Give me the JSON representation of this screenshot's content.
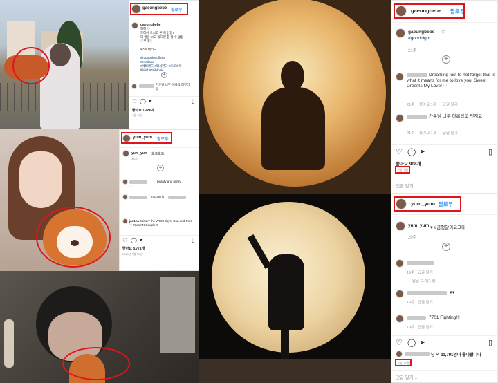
{
  "post1": {
    "username": "gaeungbebe",
    "follow": "팔로우",
    "caption_user": "gaeungbebe",
    "caption_lines": [
      "헤헤 ♡",
      "드디어 오시고 온 이 인형T",
      "데 얼굴 보고 있으면 힘 살 수 없음",
      "♡무해♡",
      "",
      "#스토베리도",
      "",
      "@3doubleoofficial",
      "#everland",
      "#에버랜드 #레서판다 #오토바이",
      "#ootd #dailylook"
    ],
    "time": "21주",
    "comment1": "가운님 너무 이뻐요 러뷰러뷰",
    "likes": "좋아요 1,486개",
    "date": "3월 16일"
  },
  "post2": {
    "username": "yum_yum",
    "follow": "팔로우",
    "caption_user": "yum_yum",
    "caption": "호호호호.",
    "time": "46주",
    "comments": [
      "beauty and pretty",
      "racoon is",
      "Missin' the WGM days! Gun and Pora ♡ #zoomN Couple ♥"
    ],
    "comment_user3": "jae1na",
    "likes": "좋아요 8,771개",
    "date": "2018년 3월 30일"
  },
  "post3": {
    "username": "gaeungbebe",
    "follow": "팔로우",
    "caption_user": "gaeungbebe",
    "caption_emoji": "♡",
    "hashtag": "#goodnight",
    "time": "21주",
    "comment1_text": "Dreaming just to not forget that is what it means for me to love you. Sweet Dreams My Love! ♡",
    "comment1_meta": [
      "21주",
      "좋아요 1개",
      "답글 달기"
    ],
    "comment2_text": "가운님 너무 아름답고 멋져요",
    "comment2_meta": [
      "21주",
      "좋아요 1개",
      "답글 달기"
    ],
    "likes": "좋아요 908개",
    "date": "3월 1일",
    "add_comment": "댓글 달기..."
  },
  "post4": {
    "username": "yum_yum",
    "follow": "팔로우",
    "caption_user": "yum_yum",
    "caption": "♥ #곰형달이요그대",
    "time": "20주",
    "comments": [
      {
        "time": "19주",
        "action": "답글 달기",
        "extra": "답글 보기(1개)"
      },
      {
        "time": "19주",
        "action": "답글 달기",
        "text": "♥♥"
      },
      {
        "time": "19주",
        "action": "답글 달기",
        "text": "7701 Fighting!!!"
      }
    ],
    "likes": "님 외 11,791명이 좋아합니다",
    "date": "3월 12일",
    "add_comment": "댓글 달기..."
  },
  "colors": {
    "highlight": "#e0151b",
    "link": "#3897f0"
  },
  "icons": [
    "heart-icon",
    "comment-icon",
    "share-icon",
    "bookmark-icon",
    "add-comment-icon",
    "verified-icon"
  ]
}
